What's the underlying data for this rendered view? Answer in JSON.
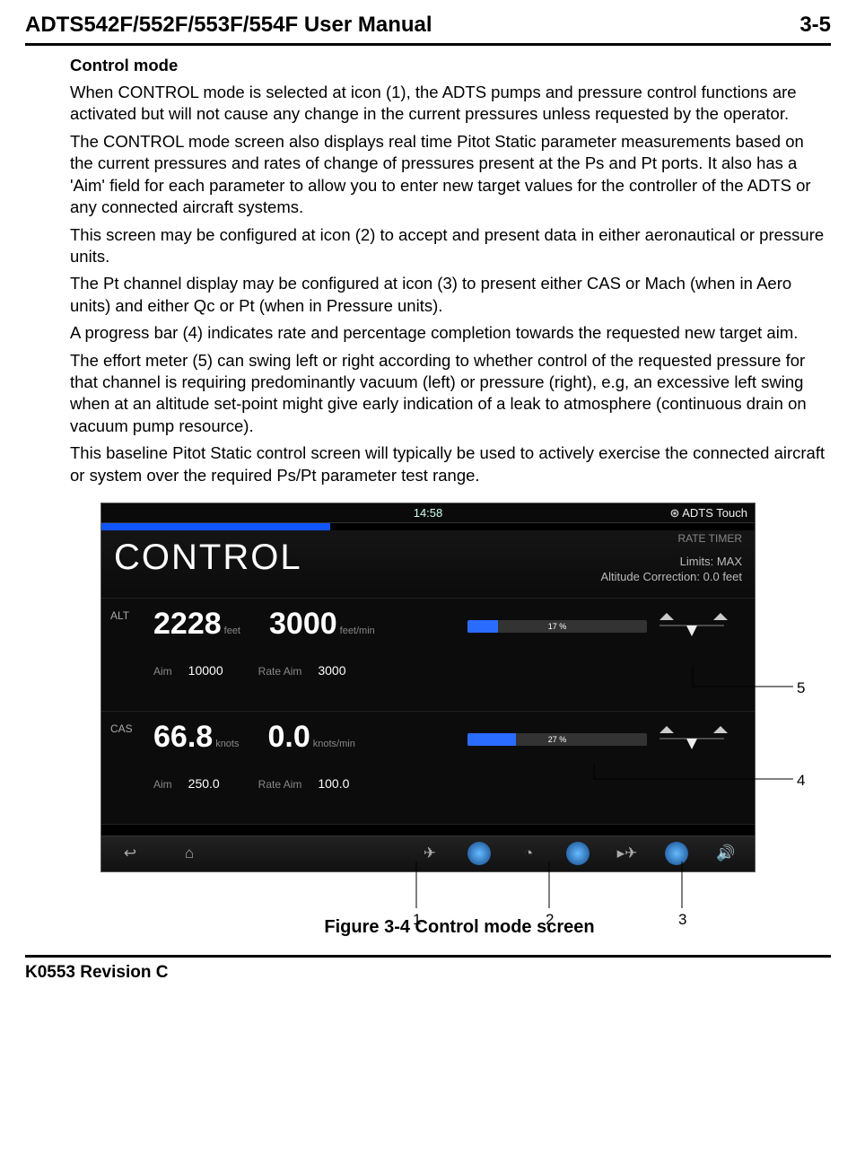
{
  "header": {
    "title": "ADTS542F/552F/553F/554F User Manual",
    "page": "3-5"
  },
  "section_title": "Control mode",
  "paragraphs": {
    "p1": "When CONTROL mode is selected at icon (1), the ADTS pumps and pressure control functions are activated but will not cause any change in the current pressures unless requested by the operator.",
    "p2": "The CONTROL mode screen also displays real time Pitot Static parameter measurements based on the current pressures and rates of change of pressures present at the Ps and Pt ports. It also has a 'Aim' field for each parameter to allow you to enter new target values for the controller of the ADTS or any connected aircraft systems.",
    "p3": "This screen may be configured at icon (2) to accept and present data in either aeronautical or pressure units.",
    "p4": "The Pt channel display may be configured at icon (3) to present either CAS or Mach (when in Aero units) and either Qc or Pt (when in Pressure units).",
    "p5": "A progress bar (4) indicates rate and percentage completion towards the requested new target aim.",
    "p6": "The effort meter (5) can swing left or right according to whether control of the requested pressure for that channel is requiring predominantly vacuum (left) or pressure (right), e.g, an excessive left swing when at an altitude set-point might give early indication of a leak to atmosphere (continuous drain on vacuum pump resource).",
    "p7": "This baseline Pitot Static control screen will typically be used to actively exercise the connected aircraft or system over the required Ps/Pt parameter test range."
  },
  "figure_caption": "Figure 3-4 Control mode screen",
  "screen": {
    "time": "14:58",
    "brand": "ADTS Touch",
    "rate_timer_label": "RATE TIMER",
    "mode_title": "CONTROL",
    "limits_line1": "Limits: MAX",
    "limits_line2": "Altitude Correction: 0.0 feet",
    "alt": {
      "label": "ALT",
      "value": "2228",
      "value_unit": "feet",
      "rate": "3000",
      "rate_unit": "feet/min",
      "aim_label": "Aim",
      "aim_value": "10000",
      "rate_aim_label": "Rate Aim",
      "rate_aim_value": "3000",
      "progress_pct": "17 %",
      "progress_fill": 17
    },
    "cas": {
      "label": "CAS",
      "value": "66.8",
      "value_unit": "knots",
      "rate": "0.0",
      "rate_unit": "knots/min",
      "aim_label": "Aim",
      "aim_value": "250.0",
      "rate_aim_label": "Rate Aim",
      "rate_aim_value": "100.0",
      "progress_pct": "27 %",
      "progress_fill": 27
    }
  },
  "callouts": {
    "c1": "1",
    "c2": "2",
    "c3": "3",
    "c4": "4",
    "c5": "5"
  },
  "footer": "K0553 Revision C"
}
